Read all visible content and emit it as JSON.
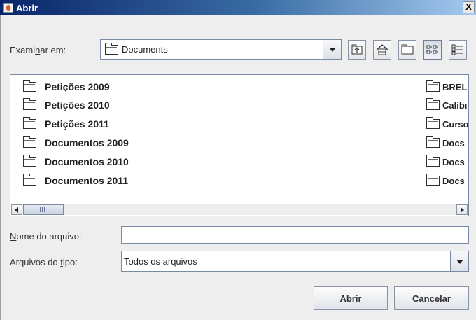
{
  "window": {
    "title": "Abrir",
    "close_glyph": "X"
  },
  "lookin": {
    "label_pre": "Exami",
    "label_mnemonic": "n",
    "label_post": "ar em:",
    "value": "Documents"
  },
  "toolbar": {
    "buttons": [
      "up-one-level-icon",
      "home-icon",
      "new-folder-icon",
      "list-view-icon",
      "details-view-icon"
    ],
    "active_view": "list"
  },
  "files": {
    "column1": [
      "Petições 2009",
      "Petições 2010",
      "Petições 2011",
      "Documentos 2009",
      "Documentos 2010",
      "Documentos 2011"
    ],
    "column2": [
      "BREL",
      "Calibı",
      "Curso",
      "Docs",
      "Docs",
      "Docs"
    ]
  },
  "filename": {
    "label_mnemonic": "N",
    "label_post": "ome do arquivo:",
    "value": ""
  },
  "filetype": {
    "label_pre": "Arquivos do ",
    "label_mnemonic": "t",
    "label_post": "ipo:",
    "value": "Todos os arquivos"
  },
  "buttons": {
    "open": "Abrir",
    "cancel": "Cancelar"
  },
  "colors": {
    "titlebar_start": "#0a246a",
    "titlebar_end": "#a6caf0",
    "background": "#eeeeee"
  }
}
